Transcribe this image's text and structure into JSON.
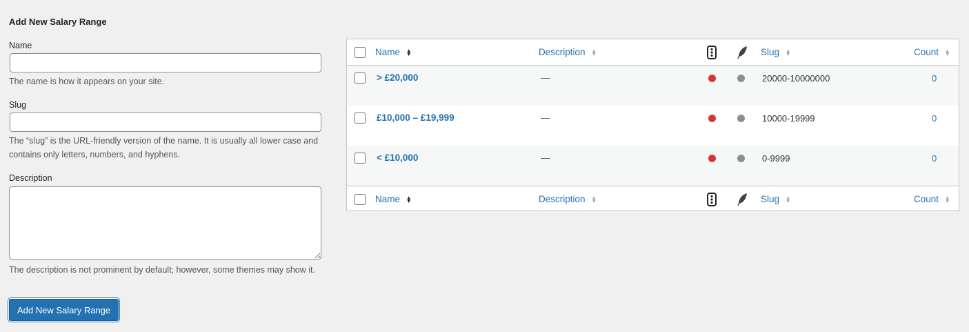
{
  "form": {
    "title": "Add New Salary Range",
    "name": {
      "label": "Name",
      "value": "",
      "help": "The name is how it appears on your site."
    },
    "slug": {
      "label": "Slug",
      "value": "",
      "help": "The “slug” is the URL-friendly version of the name. It is usually all lower case and contains only letters, numbers, and hyphens."
    },
    "description": {
      "label": "Description",
      "value": "",
      "help": "The description is not prominent by default; however, some themes may show it."
    },
    "submit_label": "Add New Salary Range"
  },
  "table": {
    "columns": {
      "name": "Name",
      "description": "Description",
      "slug": "Slug",
      "count": "Count"
    },
    "icons": {
      "status": "traffic-light-icon",
      "featured": "feather-icon"
    },
    "status_colors": {
      "red": "#d63638",
      "gray": "#8c8f94"
    },
    "rows": [
      {
        "name": "> £20,000",
        "description": "—",
        "slug": "20000-10000000",
        "count": "0"
      },
      {
        "name": "£10,000 – £19,999",
        "description": "—",
        "slug": "10000-19999",
        "count": "0"
      },
      {
        "name": "< £10,000",
        "description": "—",
        "slug": "0-9999",
        "count": "0"
      }
    ]
  },
  "colors": {
    "accent": "#2271b1",
    "background": "#f0f0f1"
  }
}
